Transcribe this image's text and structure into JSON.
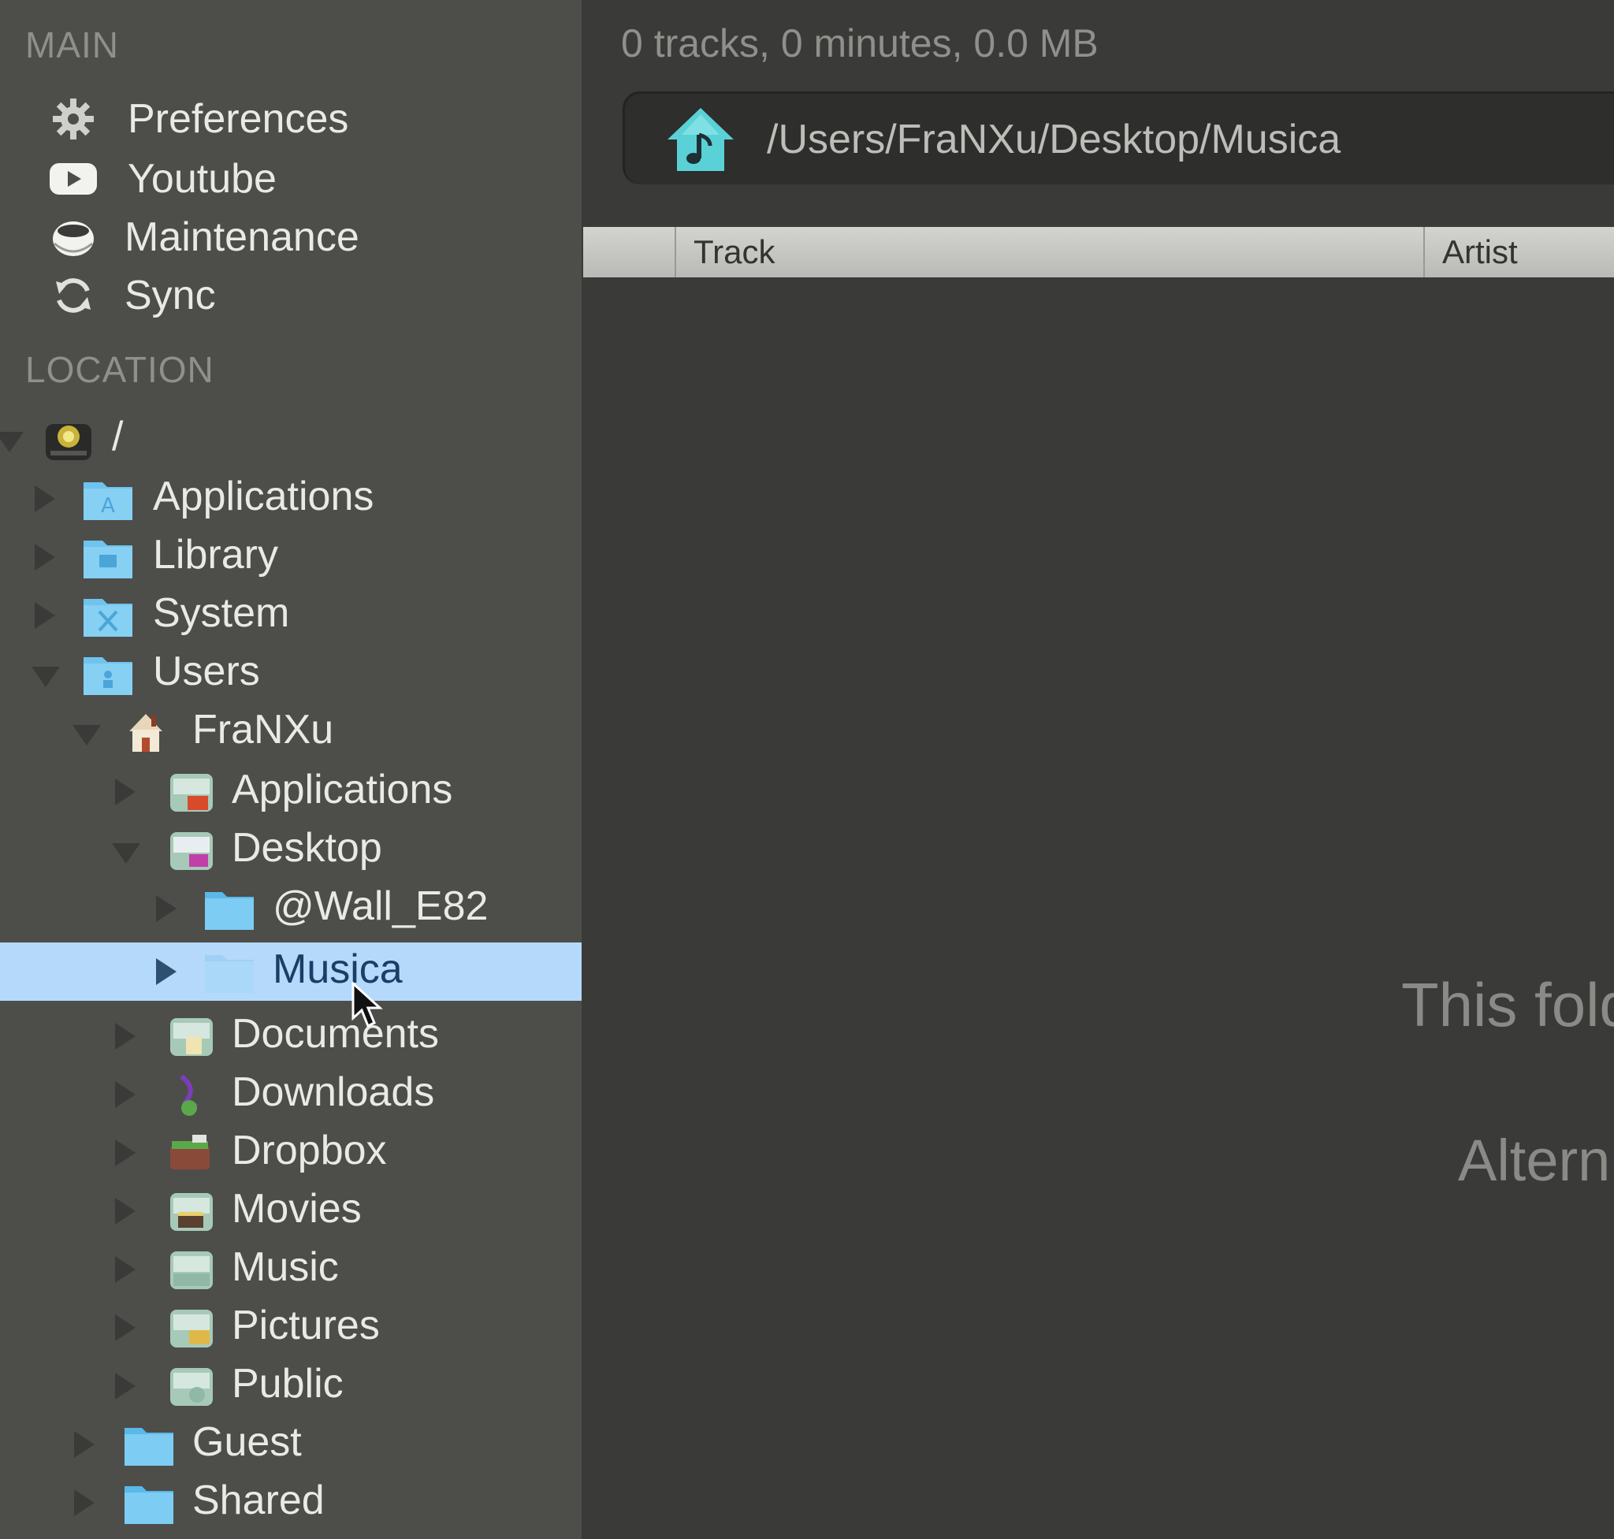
{
  "sidebar": {
    "main_header": "MAIN",
    "main_items": [
      {
        "label": "Preferences",
        "icon": "gear-icon"
      },
      {
        "label": "Youtube",
        "icon": "youtube-play-icon"
      },
      {
        "label": "Maintenance",
        "icon": "coffee-cup-icon"
      },
      {
        "label": "Sync",
        "icon": "sync-icon"
      }
    ],
    "location_header": "LOCATION",
    "tree": [
      {
        "label": "/",
        "icon": "hard-drive-icon",
        "expanded": true
      },
      {
        "label": "Applications",
        "icon": "applications-folder-icon",
        "expanded": false
      },
      {
        "label": "Library",
        "icon": "library-folder-icon",
        "expanded": false
      },
      {
        "label": "System",
        "icon": "system-folder-icon",
        "expanded": false
      },
      {
        "label": "Users",
        "icon": "users-folder-icon",
        "expanded": true
      },
      {
        "label": "FraNXu",
        "icon": "home-icon",
        "expanded": true
      },
      {
        "label": "Applications",
        "icon": "applications-folder-icon",
        "expanded": false
      },
      {
        "label": "Desktop",
        "icon": "desktop-folder-icon",
        "expanded": true
      },
      {
        "label": "@Wall_E82",
        "icon": "folder-icon",
        "expanded": false
      },
      {
        "label": "Musica",
        "icon": "folder-icon",
        "expanded": false,
        "selected": true
      },
      {
        "label": "Documents",
        "icon": "documents-folder-icon",
        "expanded": false
      },
      {
        "label": "Downloads",
        "icon": "downloads-folder-icon",
        "expanded": false
      },
      {
        "label": "Dropbox",
        "icon": "dropbox-folder-icon",
        "expanded": false
      },
      {
        "label": "Movies",
        "icon": "movies-folder-icon",
        "expanded": false
      },
      {
        "label": "Music",
        "icon": "music-folder-icon",
        "expanded": false
      },
      {
        "label": "Pictures",
        "icon": "pictures-folder-icon",
        "expanded": false
      },
      {
        "label": "Public",
        "icon": "public-folder-icon",
        "expanded": false
      },
      {
        "label": "Guest",
        "icon": "folder-icon",
        "expanded": false
      },
      {
        "label": "Shared",
        "icon": "folder-icon",
        "expanded": false
      }
    ]
  },
  "main": {
    "summary": "0 tracks, 0 minutes, 0.0 MB",
    "path": "/Users/FraNXu/Desktop/Musica",
    "path_icon": "music-home-icon",
    "columns": [
      "Track",
      "Artist"
    ],
    "empty_title": "This fold",
    "empty_sub": "Altern"
  },
  "colors": {
    "sidebar_bg": "#4d4d4a",
    "main_bg": "#3a3a38",
    "selection": "#b4d9fb",
    "folder_blue": "#6fc3ef",
    "home_teal": "#5ad1d6"
  }
}
